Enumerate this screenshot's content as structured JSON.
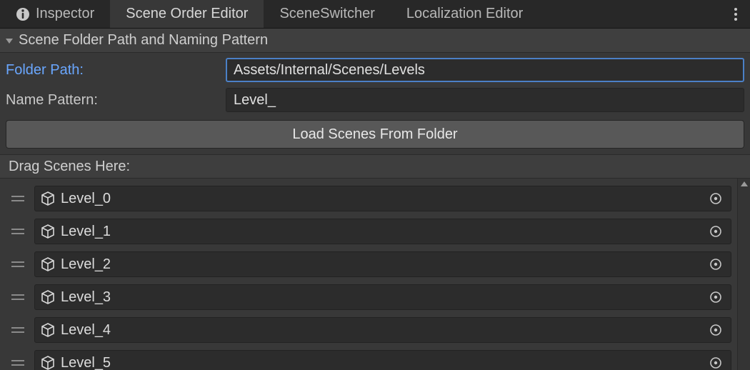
{
  "tabs": [
    {
      "label": "Inspector",
      "has_info_icon": true,
      "active": false
    },
    {
      "label": "Scene Order Editor",
      "has_info_icon": false,
      "active": true
    },
    {
      "label": "SceneSwitcher",
      "has_info_icon": false,
      "active": false
    },
    {
      "label": "Localization Editor",
      "has_info_icon": false,
      "active": false
    }
  ],
  "section": {
    "title": "Scene Folder Path and Naming Pattern"
  },
  "form": {
    "folder_path_label": "Folder Path:",
    "folder_path_value": "Assets/Internal/Scenes/Levels",
    "name_pattern_label": "Name Pattern:",
    "name_pattern_value": "Level_",
    "load_button_label": "Load Scenes From Folder"
  },
  "dragzone": {
    "label": "Drag Scenes Here:"
  },
  "scenes": [
    {
      "name": "Level_0"
    },
    {
      "name": "Level_1"
    },
    {
      "name": "Level_2"
    },
    {
      "name": "Level_3"
    },
    {
      "name": "Level_4"
    },
    {
      "name": "Level_5"
    }
  ],
  "colors": {
    "accent": "#6aa7ff",
    "focus_border": "#4b80c6"
  }
}
